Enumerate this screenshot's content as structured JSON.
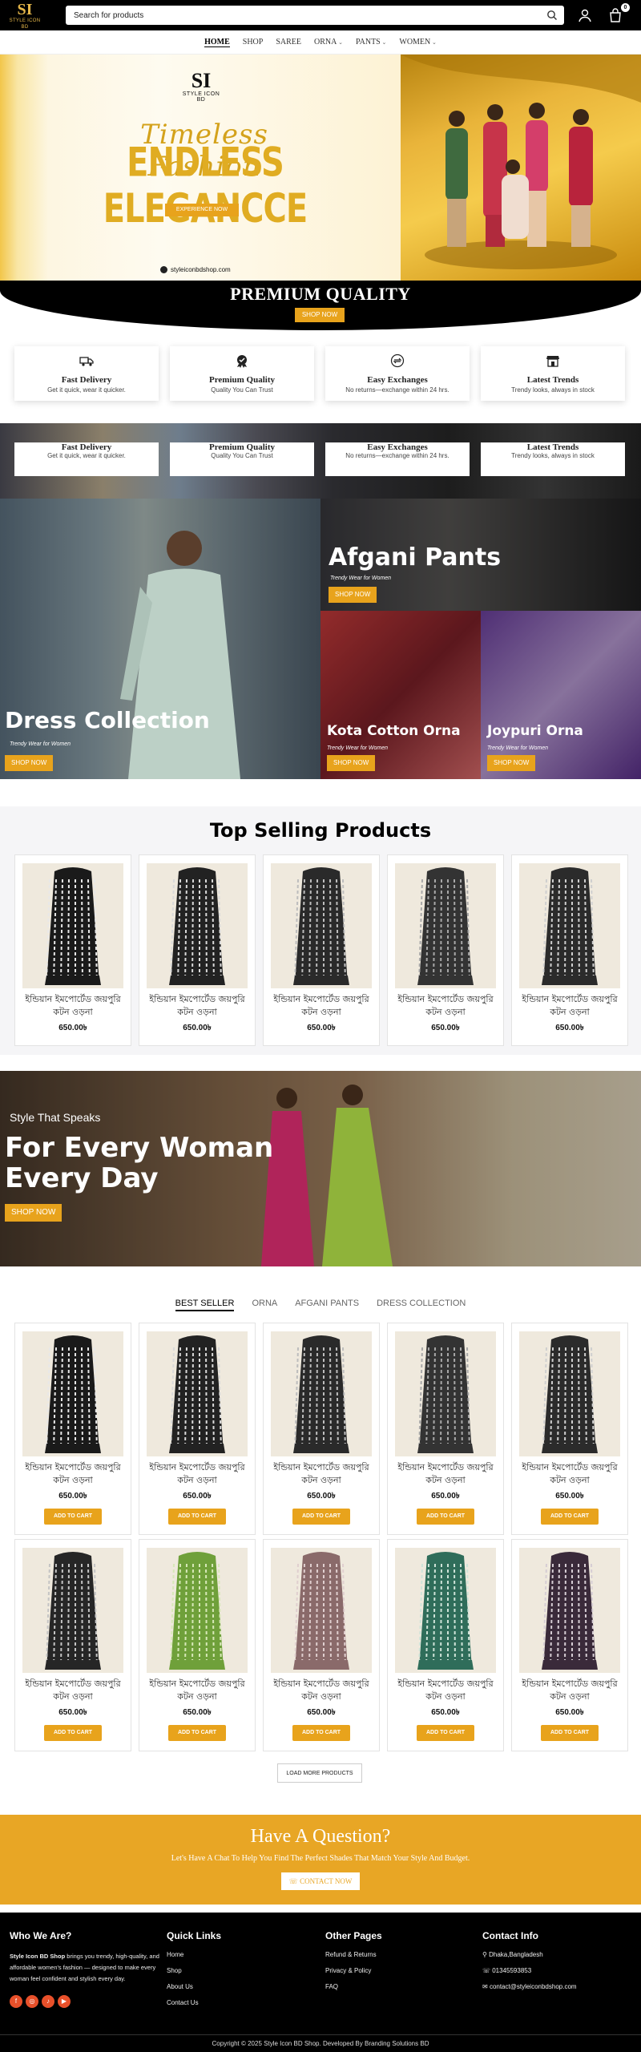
{
  "header": {
    "logo_text": "SI",
    "logo_sub": "STYLE ICON BD",
    "search_placeholder": "Search for products",
    "cart_count": "0"
  },
  "nav": [
    "HOME",
    "SHOP",
    "SAREE",
    "ORNA",
    "PANTS",
    "WOMEN"
  ],
  "hero": {
    "logo_mark": "SI",
    "logo_sub": "STYLE ICON BD",
    "script": "Timeless Fashion",
    "headline": "ENDLESS ELEGANCCE",
    "cta": "EXPERIENCE NOW",
    "url": "styleiconbdshop.com"
  },
  "premium": {
    "title": "PREMIUM QUALITY",
    "cta": "SHOP NOW"
  },
  "features": [
    {
      "title": "Fast Delivery",
      "sub": "Get it quick, wear it quicker."
    },
    {
      "title": "Premium Quality",
      "sub": "Quality You Can Trust"
    },
    {
      "title": "Easy Exchanges",
      "sub": "No returns—exchange within 24 hrs."
    },
    {
      "title": "Latest Trends",
      "sub": "Trendy looks, always in stock"
    }
  ],
  "banners": {
    "dress": {
      "title": "Dress Collection",
      "sub": "Trendy Wear for Women",
      "cta": "SHOP NOW"
    },
    "afgani": {
      "title": "Afgani Pants",
      "sub": "Trendy Wear for Women",
      "cta": "SHOP NOW"
    },
    "kota": {
      "title": "Kota Cotton Orna",
      "sub": "Trendy Wear for Women",
      "cta": "SHOP NOW"
    },
    "joypuri": {
      "title": "Joypuri Orna",
      "sub": "Trendy Wear for Women",
      "cta": "SHOP NOW"
    }
  },
  "top_selling": {
    "title": "Top Selling Products",
    "products": [
      {
        "name": "ইন্ডিয়ান ইমপোর্টেড জয়পুরি কটন ওড়না",
        "price": "650.00৳"
      },
      {
        "name": "ইন্ডিয়ান ইমপোর্টেড জয়পুরি কটন ওড়না",
        "price": "650.00৳"
      },
      {
        "name": "ইন্ডিয়ান ইমপোর্টেড জয়পুরি কটন ওড়না",
        "price": "650.00৳"
      },
      {
        "name": "ইন্ডিয়ান ইমপোর্টেড জয়পুরি কটন ওড়না",
        "price": "650.00৳"
      },
      {
        "name": "ইন্ডিয়ান ইমপোর্টেড জয়পুরি কটন ওড়না",
        "price": "650.00৳"
      }
    ]
  },
  "promo": {
    "kicker": "Style That Speaks",
    "line1": "For Every Woman",
    "line2": "Every Day",
    "cta": "SHOP NOW"
  },
  "tabs": [
    "BEST SELLER",
    "ORNA",
    "AFGANI PANTS",
    "DRESS COLLECTION"
  ],
  "grid": {
    "add_to_cart": "ADD TO CART",
    "products": [
      {
        "name": "ইন্ডিয়ান ইমপোর্টেড জয়পুরি কটন ওড়না",
        "price": "650.00৳"
      },
      {
        "name": "ইন্ডিয়ান ইমপোর্টেড জয়পুরি কটন ওড়না",
        "price": "650.00৳"
      },
      {
        "name": "ইন্ডিয়ান ইমপোর্টেড জয়পুরি কটন ওড়না",
        "price": "650.00৳"
      },
      {
        "name": "ইন্ডিয়ান ইমপোর্টেড জয়পুরি কটন ওড়না",
        "price": "650.00৳"
      },
      {
        "name": "ইন্ডিয়ান ইমপোর্টেড জয়পুরি কটন ওড়না",
        "price": "650.00৳"
      },
      {
        "name": "ইন্ডিয়ান ইমপোর্টেড জয়পুরি কটন ওড়না",
        "price": "650.00৳"
      },
      {
        "name": "ইন্ডিয়ান ইমপোর্টেড জয়পুরি কটন ওড়না",
        "price": "650.00৳"
      },
      {
        "name": "ইন্ডিয়ান ইমপোর্টেড জয়পুরি কটন ওড়না",
        "price": "650.00৳"
      },
      {
        "name": "ইন্ডিয়ান ইমপোর্টেড জয়পুরি কটন ওড়না",
        "price": "650.00৳"
      },
      {
        "name": "ইন্ডিয়ান ইমপোর্টেড জয়পুরি কটন ওড়না",
        "price": "650.00৳"
      }
    ],
    "load_more": "LOAD MORE PRODUCTS"
  },
  "question": {
    "title": "Have A Question?",
    "sub": "Let's Have A Chat To Help You Find The Perfect Shades That Match Your Style And Budget.",
    "cta": "CONTACT NOW"
  },
  "footer": {
    "who_title": "Who We Are?",
    "who_brand": "Style Icon BD Shop",
    "who_text": " brings you trendy, high-quality, and affordable women's fashion — designed to make every woman feel confident and stylish every day.",
    "quick_title": "Quick Links",
    "quick_links": [
      "Home",
      "Shop",
      "About Us",
      "Contact Us"
    ],
    "other_title": "Other Pages",
    "other_links": [
      "Refund & Returns",
      "Privacy & Policy",
      "FAQ"
    ],
    "contact_title": "Contact Info",
    "contact": [
      "Dhaka,Bangladesh",
      "01345593853",
      "contact@styleiconbdshop.com"
    ],
    "copyright": "Copyright © 2025 Style Icon BD Shop. Developed By Branding Solutions BD"
  },
  "colors": {
    "accent": "#e8a31c",
    "dark": "#000000"
  }
}
